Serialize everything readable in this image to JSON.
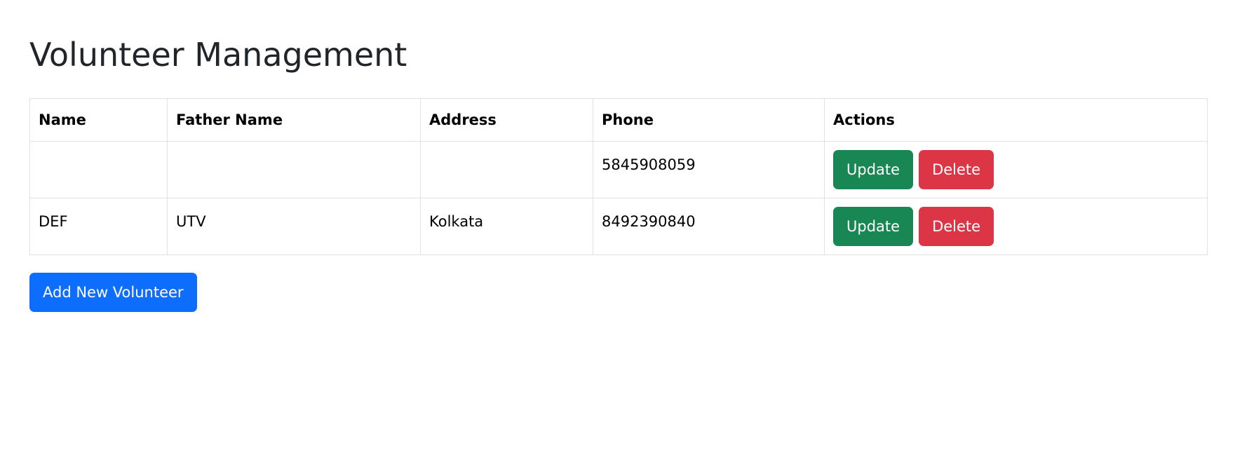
{
  "page": {
    "title": "Volunteer Management"
  },
  "table": {
    "headers": [
      "Name",
      "Father Name",
      "Address",
      "Phone",
      "Actions"
    ],
    "rows": [
      {
        "name": "",
        "father_name": "",
        "address": "",
        "phone": "5845908059",
        "update_label": "Update",
        "delete_label": "Delete"
      },
      {
        "name": "DEF",
        "father_name": "UTV",
        "address": "Kolkata",
        "phone": "8492390840",
        "update_label": "Update",
        "delete_label": "Delete"
      }
    ]
  },
  "add_button": {
    "label": "Add New Volunteer"
  },
  "colors": {
    "update": "#198754",
    "delete": "#dc3545",
    "primary": "#0d6efd"
  }
}
